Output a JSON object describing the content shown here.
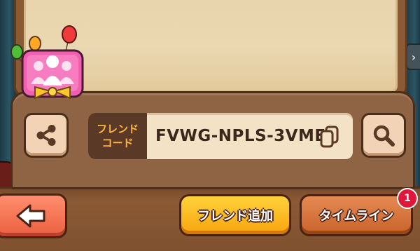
{
  "friend_code": {
    "label_line1": "フレンド",
    "label_line2": "コード",
    "value": "FVWG-NPLS-3VME"
  },
  "buttons": {
    "add_friend": "フレンド追加",
    "timeline": "タイムライン",
    "timeline_badge": "1"
  },
  "icons": {
    "share": "share-icon",
    "copy": "copy-icon",
    "search": "search-icon",
    "back": "back-arrow-icon",
    "friends": "friends-balloon-badge-icon",
    "scroll_right": "chevron-right-icon"
  },
  "colors": {
    "add_button": "#f7a40f",
    "timeline_button": "#c9622a",
    "back_button": "#ea5f40",
    "badge": "#e0163a",
    "code_label_text": "#ffb446"
  }
}
